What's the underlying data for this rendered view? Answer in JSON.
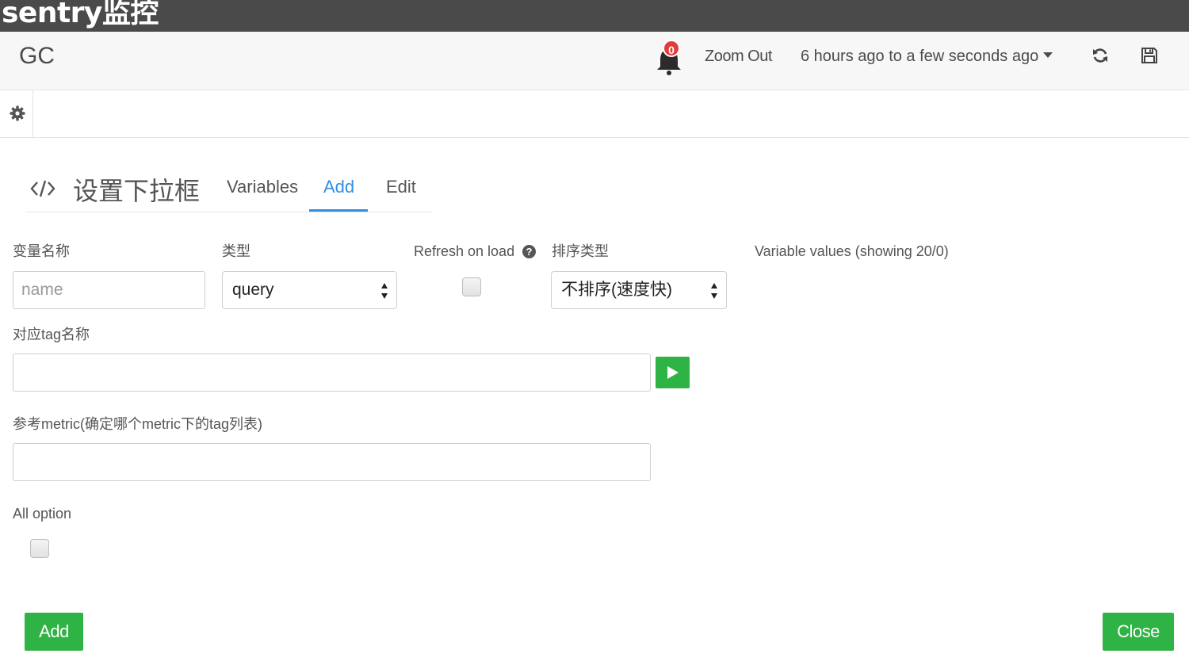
{
  "titlebar": {
    "title": "sentry监控"
  },
  "navbar": {
    "dashboard_title": "GC",
    "alert_count": "0",
    "zoom_out": "Zoom Out",
    "time_range": "6 hours ago to a few seconds ago",
    "icons": [
      "bell-icon",
      "refresh-icon",
      "save-icon"
    ]
  },
  "settings": {
    "icon": "gear-icon"
  },
  "editor": {
    "title": "设置下拉框",
    "tabs": [
      {
        "label": "Variables",
        "active": false
      },
      {
        "label": "Add",
        "active": true
      },
      {
        "label": "Edit",
        "active": false
      }
    ]
  },
  "form": {
    "name_label": "变量名称",
    "name_placeholder": "name",
    "type_label": "类型",
    "type_value": "query",
    "refresh_label": "Refresh on load",
    "refresh_checked": false,
    "sort_label": "排序类型",
    "sort_value": "不排序(速度快)",
    "values_label": "Variable values (showing 20/0)",
    "tag_label": "对应tag名称",
    "tag_value": "",
    "metric_label": "参考metric(确定哪个metric下的tag列表)",
    "metric_value": "",
    "all_option_label": "All option",
    "all_option_checked": false
  },
  "footer": {
    "add_label": "Add",
    "close_label": "Close"
  },
  "colors": {
    "accent": "#2f8fe0",
    "success": "#2fb344",
    "badge": "#e53a3a",
    "titlebar": "#4a4a4a"
  }
}
